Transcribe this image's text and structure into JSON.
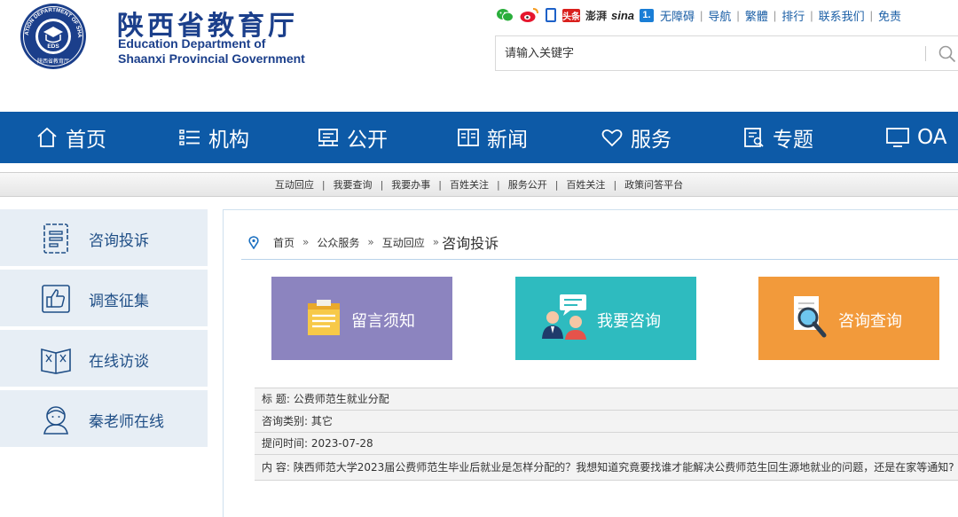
{
  "header": {
    "brand_cn": "陕西省教育厅",
    "brand_en_line1": "Education Department of",
    "brand_en_line2": "Shaanxi Provincial Government",
    "emblem_center": "EDS",
    "emblem_ring": "EDUCATION DEPARTMENT OF SHAANXI",
    "emblem_bottom": "陕西省教育厅",
    "social": {
      "toutiao": "头条",
      "pengpai": "澎湃",
      "sina": "sina",
      "yidian": "1."
    },
    "toplinks": [
      "无障碍",
      "导航",
      "繁體",
      "排行",
      "联系我们",
      "免责"
    ],
    "search": {
      "placeholder": "请输入关键字"
    }
  },
  "nav": {
    "items": [
      {
        "label": "首页",
        "icon": "home-icon"
      },
      {
        "label": "机构",
        "icon": "list-icon"
      },
      {
        "label": "公开",
        "icon": "stamp-icon"
      },
      {
        "label": "新闻",
        "icon": "book-icon"
      },
      {
        "label": "服务",
        "icon": "heart-icon"
      },
      {
        "label": "专题",
        "icon": "document-search-icon"
      },
      {
        "label": "OA",
        "icon": "monitor-icon"
      }
    ]
  },
  "subnav": {
    "items": [
      "互动回应",
      "我要查询",
      "我要办事",
      "百姓关注",
      "服务公开",
      "百姓关注",
      "政策问答平台"
    ]
  },
  "side": {
    "items": [
      {
        "label": "咨询投诉",
        "icon": "consult-icon"
      },
      {
        "label": "调查征集",
        "icon": "thumbs-up-icon"
      },
      {
        "label": "在线访谈",
        "icon": "open-book-icon"
      },
      {
        "label": "秦老师在线",
        "icon": "teacher-icon"
      }
    ]
  },
  "breadcrumb": {
    "items": [
      "首页",
      "公众服务",
      "互动回应"
    ],
    "current": "咨询投诉"
  },
  "tiles": [
    {
      "label": "留言须知",
      "color": "#8c84bf"
    },
    {
      "label": "我要咨询",
      "color": "#2ebbbf"
    },
    {
      "label": "咨询查询",
      "color": "#f29a3b"
    }
  ],
  "detail": {
    "title_label": "标 题:",
    "title_value": "公费师范生就业分配",
    "category_label": "咨询类别:",
    "category_value": "其它",
    "time_label": "提问时间:",
    "time_value": "2023-07-28",
    "content_label": "内 容:",
    "content_value": "陕西师范大学2023届公费师范生毕业后就业是怎样分配的？我想知道究竟要找谁才能解决公费师范生回生源地就业的问题，还是在家等通知?"
  },
  "colors": {
    "nav_bg": "#0d5aa7",
    "brand": "#1b3f8b",
    "side_bg": "#e7eef5"
  }
}
